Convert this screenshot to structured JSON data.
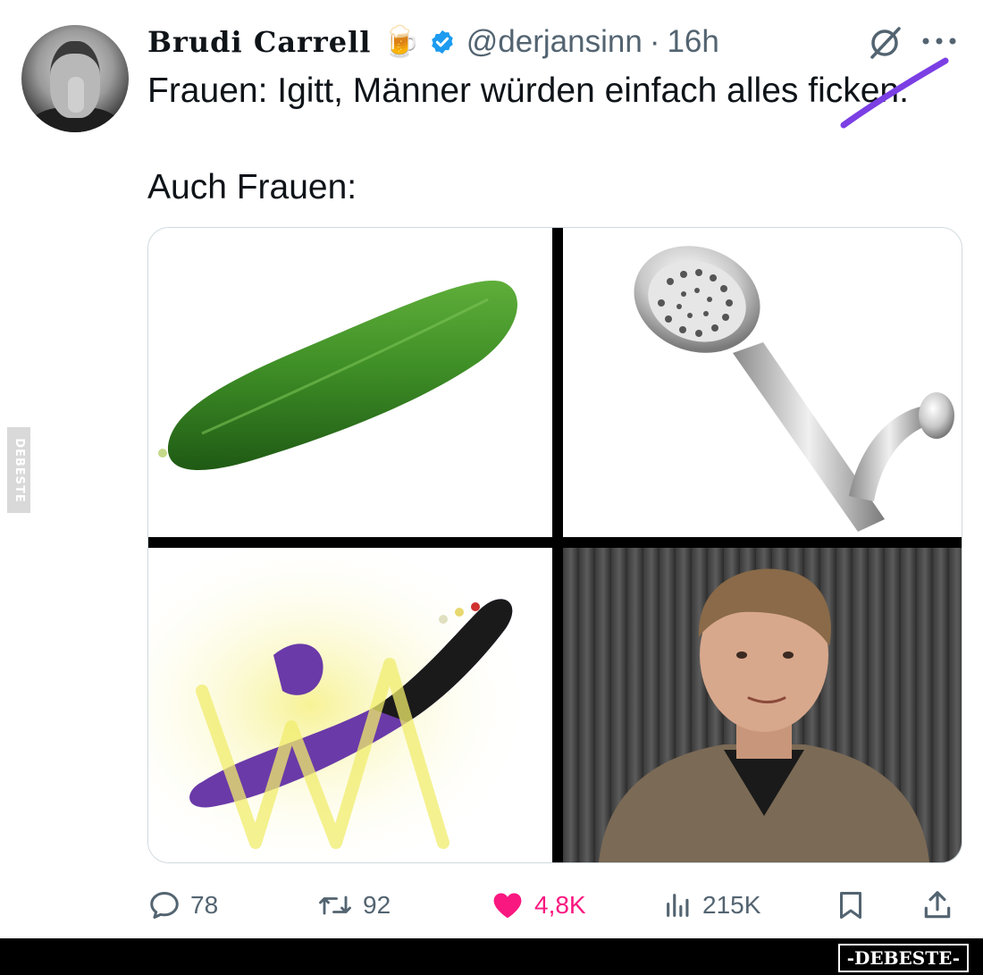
{
  "tweet": {
    "display_name": "Brudi Carrell",
    "name_emoji": "🍺",
    "handle": "@derjansinn",
    "separator": "·",
    "time": "16h",
    "line1": "Frauen: Igitt, Männer würden einfach alles ficken.",
    "line2": "Auch Frauen:"
  },
  "actions": {
    "replies": "78",
    "retweets": "92",
    "likes": "4,8K",
    "views": "215K"
  },
  "watermark": {
    "side": "DEBESTE",
    "footer": "-DEBESTE-"
  },
  "colors": {
    "like": "#f91880",
    "verified": "#1d9bf0",
    "strike": "#7b3fe4",
    "text_secondary": "#536471"
  }
}
